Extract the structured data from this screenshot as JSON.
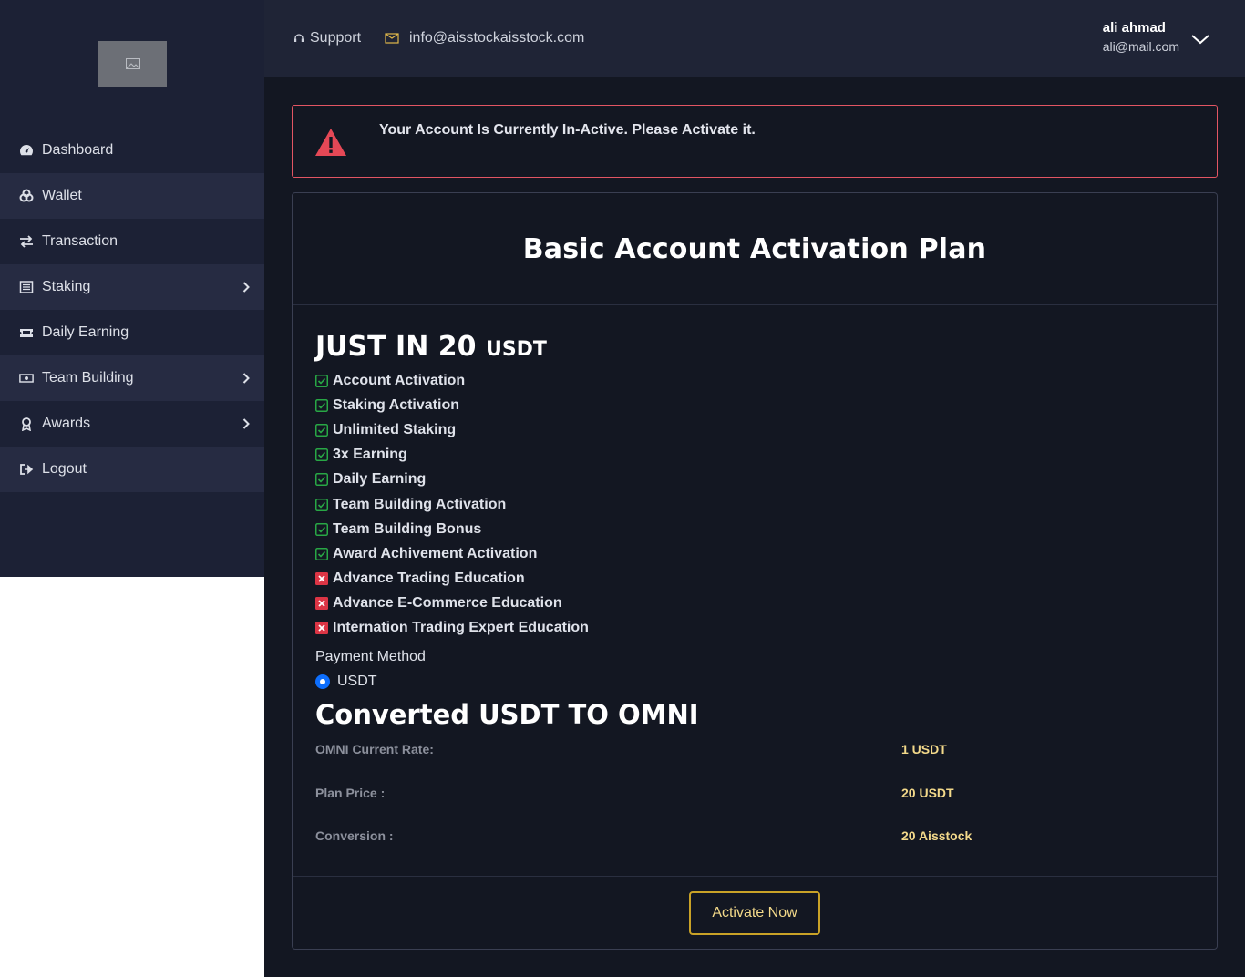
{
  "sidebar": {
    "items": [
      {
        "label": "Dashboard",
        "icon": "speedometer-icon"
      },
      {
        "label": "Wallet",
        "icon": "coins-icon"
      },
      {
        "label": "Transaction",
        "icon": "exchange-icon"
      },
      {
        "label": "Staking",
        "icon": "list-icon"
      },
      {
        "label": "Daily Earning",
        "icon": "ticket-icon"
      },
      {
        "label": "Team Building",
        "icon": "money-bill-icon"
      },
      {
        "label": "Awards",
        "icon": "award-icon"
      },
      {
        "label": "Logout",
        "icon": "sign-out-icon"
      }
    ]
  },
  "header": {
    "support_label": "Support",
    "email": "info@aisstockaisstock.com",
    "user_name": "ali ahmad",
    "user_email": "ali@mail.com"
  },
  "alert": {
    "message": "Your Account Is Currently In-Active. Please Activate it."
  },
  "plan": {
    "title": "Basic Account Activation Plan",
    "price_prefix": "JUST IN 20",
    "price_unit": "USDT",
    "features": [
      {
        "label": "Account Activation",
        "included": true
      },
      {
        "label": "Staking Activation",
        "included": true
      },
      {
        "label": "Unlimited Staking",
        "included": true
      },
      {
        "label": "3x Earning",
        "included": true
      },
      {
        "label": "Daily Earning",
        "included": true
      },
      {
        "label": "Team Building Activation",
        "included": true
      },
      {
        "label": "Team Building Bonus",
        "included": true
      },
      {
        "label": "Award Achivement Activation",
        "included": true
      },
      {
        "label": "Advance Trading Education",
        "included": false
      },
      {
        "label": "Advance E-Commerce Education",
        "included": false
      },
      {
        "label": "Internation Trading Expert Education",
        "included": false
      }
    ],
    "payment_method_label": "Payment Method",
    "payment_option": "USDT",
    "conversion_title": "Converted USDT TO OMNI",
    "rates": [
      {
        "label": "OMNI Current Rate:",
        "value": "1 USDT"
      },
      {
        "label": "Plan Price :",
        "value": "20 USDT"
      },
      {
        "label": "Conversion :",
        "value": "20 Aisstock"
      }
    ],
    "activate_label": "Activate Now"
  },
  "colors": {
    "sidebar_bg": "#1c2135",
    "main_bg": "#131722",
    "alert_border": "#e25563",
    "check_green": "#28a745",
    "cross_red": "#dc3545",
    "accent_gold": "#c9a227"
  }
}
